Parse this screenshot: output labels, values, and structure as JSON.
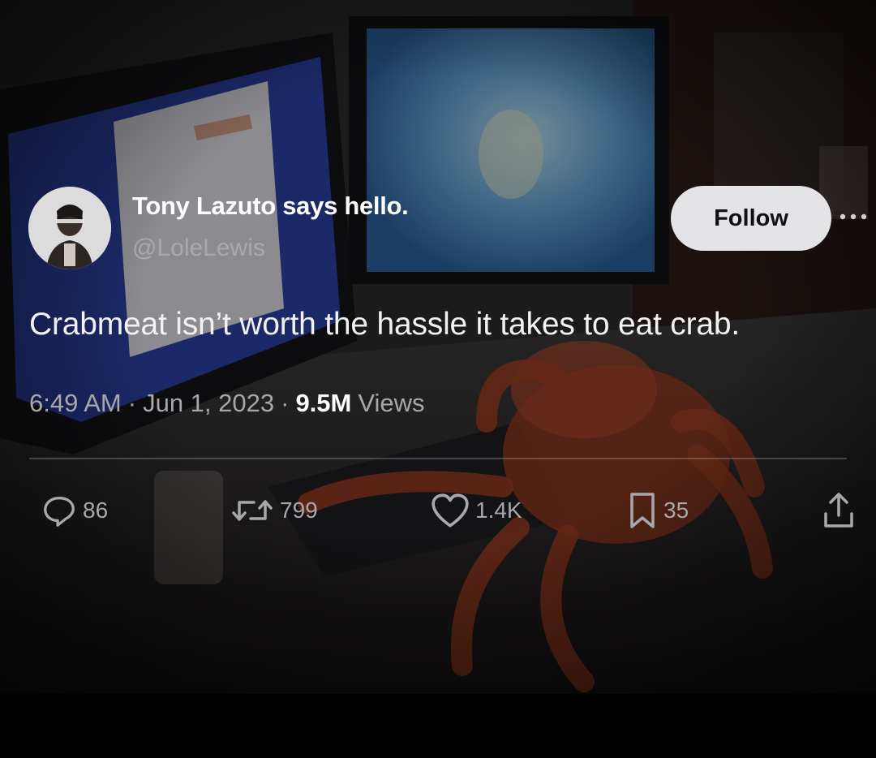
{
  "tweet": {
    "display_name": "Tony Lazuto says hello.",
    "handle": "@LoleLewis",
    "follow_label": "Follow",
    "text": "Crabmeat isn’t worth the hassle it takes to eat crab.",
    "time": "6:49 AM",
    "separator": "·",
    "date": "Jun 1, 2023",
    "views_count": "9.5M",
    "views_label": "Views"
  },
  "actions": {
    "replies": "86",
    "retweets": "799",
    "likes": "1.4K",
    "bookmarks": "35"
  },
  "icons": {
    "reply": "reply-icon",
    "retweet": "retweet-icon",
    "like": "heart-icon",
    "bookmark": "bookmark-icon",
    "share": "share-icon",
    "more": "more-icon"
  },
  "colors": {
    "primary_text": "#ffffff",
    "secondary_text": "#a7a7ac",
    "follow_bg": "#e4e4e6",
    "follow_text": "#0f1115"
  }
}
